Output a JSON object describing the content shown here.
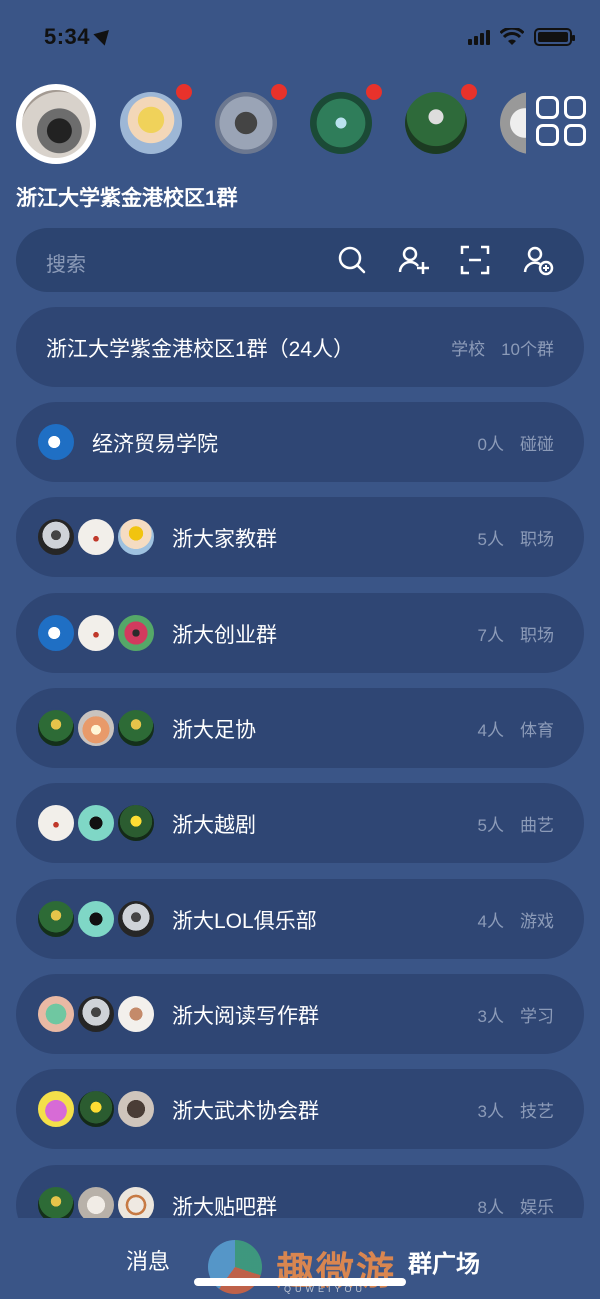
{
  "status_bar": {
    "time": "5:34"
  },
  "header": {
    "group_title": "浙江大学紫金港校区1群"
  },
  "search": {
    "placeholder": "搜索"
  },
  "current_group": {
    "name": "浙江大学紫金港校区1群（24人）",
    "category": "学校",
    "count": "10个群"
  },
  "groups": [
    {
      "name": "经济贸易学院",
      "members": "0人",
      "tag": "碰碰"
    },
    {
      "name": "浙大家教群",
      "members": "5人",
      "tag": "职场"
    },
    {
      "name": "浙大创业群",
      "members": "7人",
      "tag": "职场"
    },
    {
      "name": "浙大足协",
      "members": "4人",
      "tag": "体育"
    },
    {
      "name": "浙大越剧",
      "members": "5人",
      "tag": "曲艺"
    },
    {
      "name": "浙大LOL俱乐部",
      "members": "4人",
      "tag": "游戏"
    },
    {
      "name": "浙大阅读写作群",
      "members": "3人",
      "tag": "学习"
    },
    {
      "name": "浙大武术协会群",
      "members": "3人",
      "tag": "技艺"
    },
    {
      "name": "浙大贴吧群",
      "members": "8人",
      "tag": "娱乐"
    }
  ],
  "tabs": {
    "messages": "消息",
    "square": "群广场"
  },
  "watermark": {
    "text": "趣微游",
    "sub": "QUWEIYOU"
  },
  "colors": {
    "background": "#3a5587",
    "card": "#2f4674",
    "badge": "#e8322b"
  }
}
